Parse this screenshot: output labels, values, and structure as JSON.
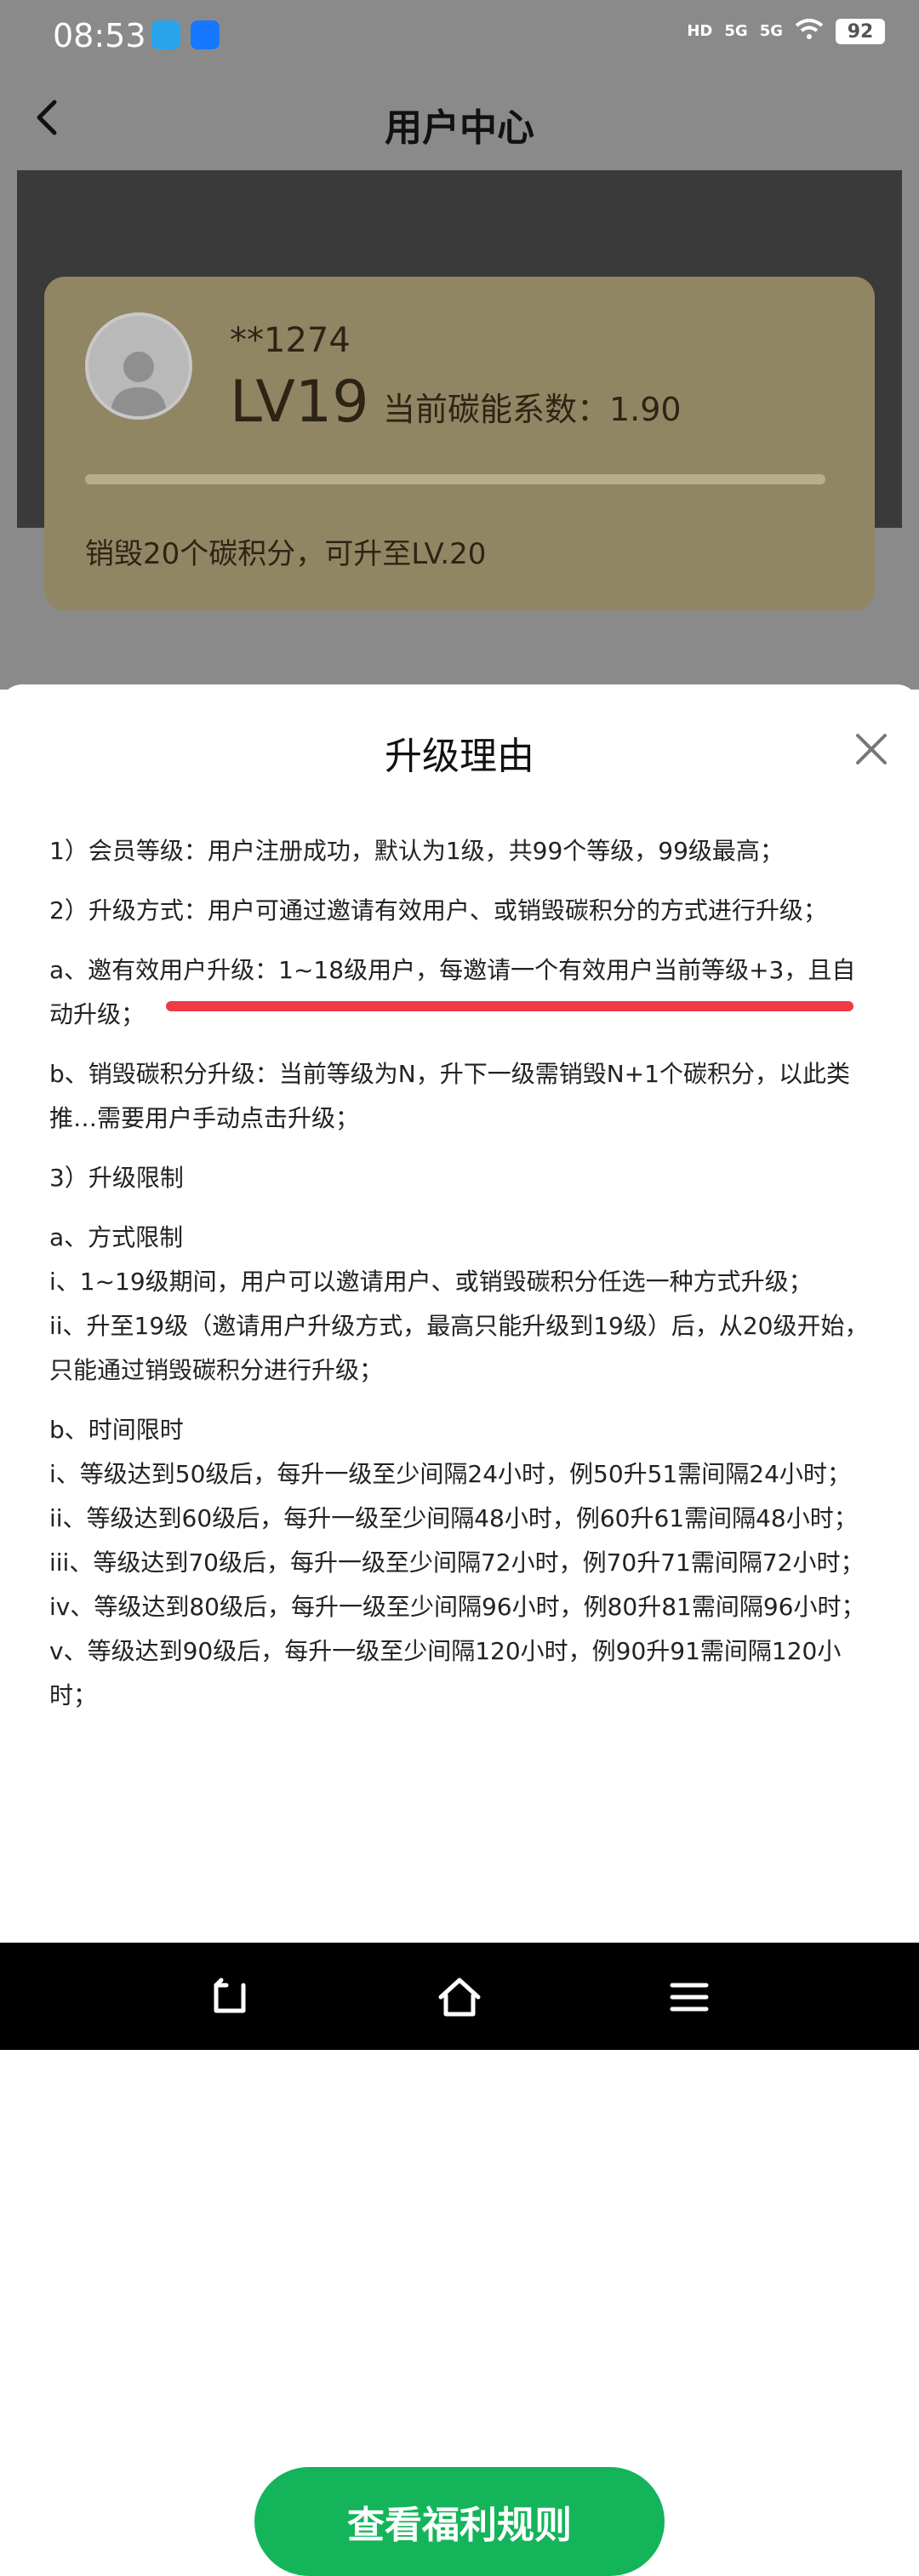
{
  "status_bar": {
    "time": "08:53",
    "network_1": "5G",
    "network_2": "5G",
    "battery": "92",
    "hd_label": "HD"
  },
  "header": {
    "title": "用户中心"
  },
  "user_card": {
    "user_id": "**1274",
    "level": "LV19",
    "coefficient": "当前碳能系数：1.90",
    "progress_percent": 100,
    "upgrade_tip": "销毁20个碳积分，可升至LV.20"
  },
  "modal": {
    "title": "升级理由",
    "rules": [
      "1）会员等级：用户注册成功，默认为1级，共99个等级，99级最高；",
      "2）升级方式：用户可通过邀请有效用户、或销毁碳积分的方式进行升级；",
      "a、邀有效用户升级：1~18级用户，每邀请一个有效用户当前等级+3，且自动升级；",
      "b、销毁碳积分升级：当前等级为N，升下一级需销毁N+1个碳积分，以此类推…需要用户手动点击升级；",
      "3）升级限制",
      "a、方式限制",
      "i、1~19级期间，用户可以邀请用户、或销毁碳积分任选一种方式升级；",
      "ii、升至19级（邀请用户升级方式，最高只能升级到19级）后，从20级开始，只能通过销毁碳积分进行升级；",
      "b、时间限时",
      "i、等级达到50级后，每升一级至少间隔24小时，例50升51需间隔24小时；",
      "ii、等级达到60级后，每升一级至少间隔48小时，例60升61需间隔48小时；",
      "iii、等级达到70级后，每升一级至少间隔72小时，例70升71需间隔72小时；",
      "iv、等级达到80级后，每升一级至少间隔96小时，例80升81需间隔96小时；",
      "v、等级达到90级后，每升一级至少间隔120小时，例90升91需间隔120小时；"
    ],
    "button_label": "查看福利规则"
  },
  "colors": {
    "overlay": "#8a8a8a",
    "card": "#918664",
    "accent_green": "#14b45a",
    "highlight_red": "#ef3b43"
  }
}
